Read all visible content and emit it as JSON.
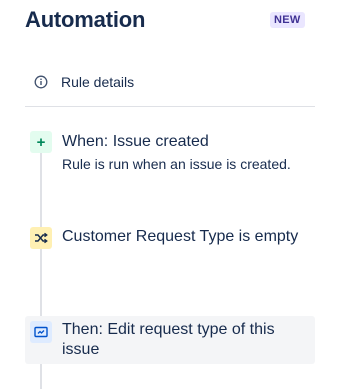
{
  "header": {
    "title": "Automation",
    "badge": "NEW"
  },
  "rule_details": {
    "icon": "info-icon",
    "label": "Rule details"
  },
  "steps": [
    {
      "type": "trigger",
      "icon": "plus-icon",
      "icon_glyph": "+",
      "title": "When: Issue created",
      "description": "Rule is run when an issue is created."
    },
    {
      "type": "condition",
      "icon": "shuffle-icon",
      "title": "Customer Request Type is empty"
    },
    {
      "type": "action",
      "icon": "edit-request-icon",
      "title": "Then: Edit request type of this issue"
    }
  ],
  "colors": {
    "trigger_bg": "#e3fcef",
    "trigger_fg": "#00875a",
    "condition_bg": "#fff0b3",
    "condition_fg": "#ff8b00",
    "action_bg": "#deebff",
    "action_fg": "#0052cc",
    "badge_bg": "#eae6ff",
    "badge_fg": "#403294"
  }
}
